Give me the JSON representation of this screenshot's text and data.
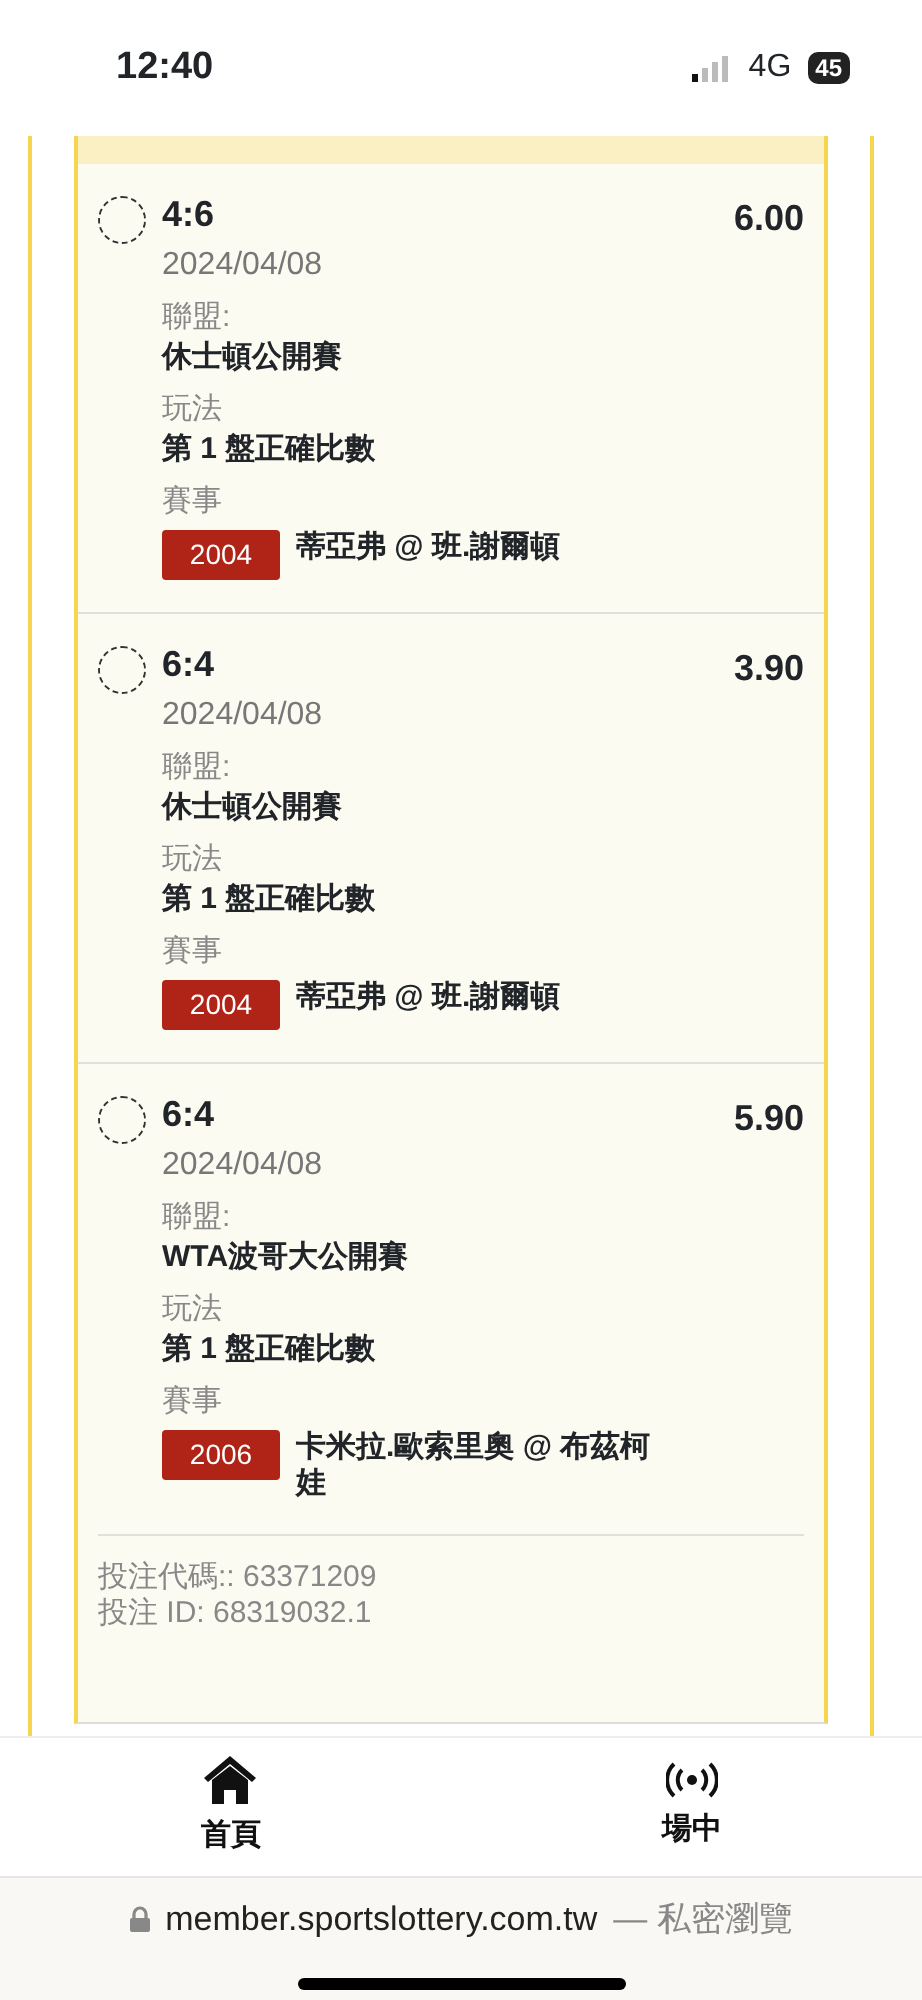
{
  "status_bar": {
    "time": "12:40",
    "network": "4G",
    "battery": "45"
  },
  "bets": [
    {
      "selected": false,
      "score": "4:6",
      "odds": "6.00",
      "date": "2024/04/08",
      "league_label": "聯盟:",
      "league": "休士頓公開賽",
      "market_label": "玩法",
      "market": "第 1 盤正確比數",
      "event_label": "賽事",
      "event_code": "2004",
      "event": "蒂亞弗 @ 班.謝爾頓"
    },
    {
      "selected": false,
      "score": "6:4",
      "odds": "3.90",
      "date": "2024/04/08",
      "league_label": "聯盟:",
      "league": "休士頓公開賽",
      "market_label": "玩法",
      "market": "第 1 盤正確比數",
      "event_label": "賽事",
      "event_code": "2004",
      "event": "蒂亞弗 @ 班.謝爾頓"
    },
    {
      "selected": false,
      "score": "6:4",
      "odds": "5.90",
      "date": "2024/04/08",
      "league_label": "聯盟:",
      "league": "WTA波哥大公開賽",
      "market_label": "玩法",
      "market": "第 1 盤正確比數",
      "event_label": "賽事",
      "event_code": "2006",
      "event": "卡米拉.歐索里奧 @ 布茲柯娃"
    }
  ],
  "bet_code": "投注代碼:: 63371209",
  "bet_id": "投注 ID: 68319032.1",
  "bottom_nav": [
    {
      "label": "首頁",
      "kind": "home"
    },
    {
      "label": "場中",
      "kind": "live"
    }
  ],
  "url_bar": {
    "domain": "member.sportslottery.com.tw",
    "mode": "— 私密瀏覽"
  }
}
